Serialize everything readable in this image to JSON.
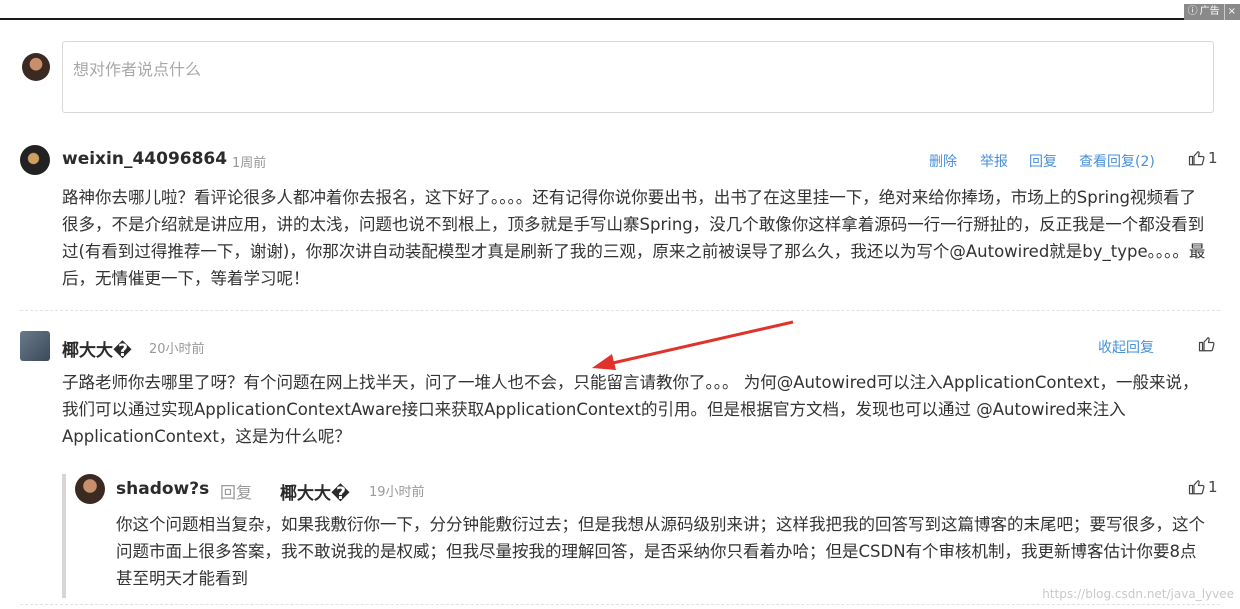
{
  "ad": {
    "label": "广告",
    "close": "×"
  },
  "input": {
    "placeholder": "想对作者说点什么"
  },
  "comments": [
    {
      "username": "weixin_44096864",
      "time": "1周前",
      "actions": {
        "delete": "删除",
        "report": "举报",
        "reply": "回复",
        "view_replies": "查看回复(2)"
      },
      "likes": "1",
      "text": "路神你去哪儿啦？看评论很多人都冲着你去报名，这下好了。。。。还有记得你说你要出书，出书了在这里挂一下，绝对来给你捧场，市场上的Spring视频看了很多，不是介绍就是讲应用，讲的太浅，问题也说不到根上，顶多就是手写山寨Spring，没几个敢像你这样拿着源码一行一行掰扯的，反正我是一个都没看到过(有看到过得推荐一下，谢谢)，你那次讲自动装配模型才真是刷新了我的三观，原来之前被误导了那么久，我还以为写个@Autowired就是by_type。。。。最后，无情催更一下，等着学习呢！"
    },
    {
      "username": "椰大大�",
      "time": "20小时前",
      "actions": {
        "collapse": "收起回复"
      },
      "text": "子路老师你去哪里了呀？有个问题在网上找半天，问了一堆人也不会，只能留言请教你了。。。 为何@Autowired可以注入ApplicationContext，一般来说，我们可以通过实现ApplicationContextAware接口来获取ApplicationContext的引用。但是根据官方文档，发现也可以通过 @Autowired来注入ApplicationContext，这是为什么呢？",
      "reply": {
        "username": "shadow?s",
        "reply_word": "回复",
        "reply_to": "椰大大�",
        "time": "19小时前",
        "likes": "1",
        "text": "你这个问题相当复杂，如果我敷衍你一下，分分钟能敷衍过去；但是我想从源码级别来讲；这样我把我的回答写到这篇博客的末尾吧；要写很多，这个问题市面上很多答案，我不敢说我的是权威；但我尽量按我的理解回答，是否采纳你只看着办哈；但是CSDN有个审核机制，我更新博客估计你要8点甚至明天才能看到"
      }
    }
  ],
  "watermark": "https://blog.csdn.net/java_lyvee",
  "colors": {
    "link": "#4a90d9",
    "arrow": "#e0332b"
  }
}
